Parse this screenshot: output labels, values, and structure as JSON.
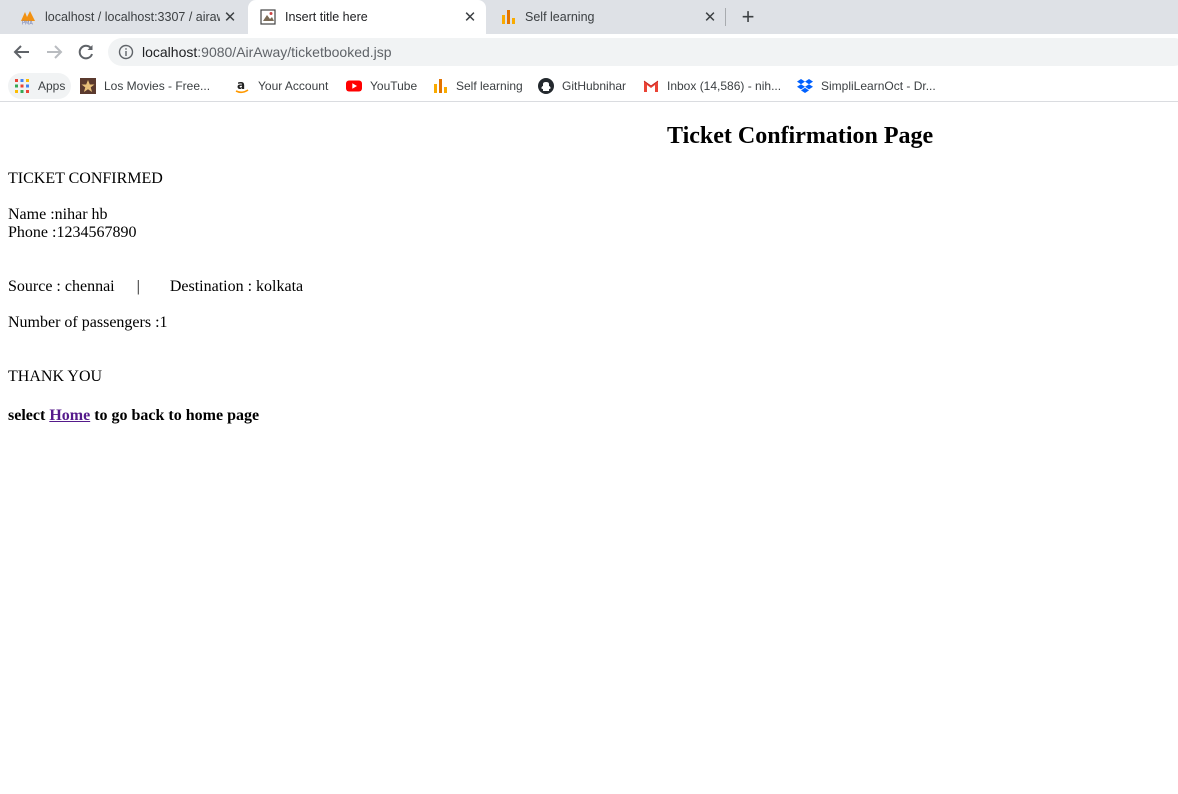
{
  "tabs": [
    {
      "title": "localhost / localhost:3307 / airaw",
      "favicon": "phpmyadmin-icon"
    },
    {
      "title": "Insert title here",
      "favicon": "image-icon"
    },
    {
      "title": "Self learning",
      "favicon": "analytics-icon"
    }
  ],
  "address": {
    "host": "localhost",
    "path": ":9080/AirAway/ticketbooked.jsp"
  },
  "bookmarks": [
    {
      "label": "Apps",
      "icon": "apps-grid-icon"
    },
    {
      "label": "Los Movies - Free...",
      "icon": "movie-icon"
    },
    {
      "label": "Your Account",
      "icon": "amazon-icon"
    },
    {
      "label": "YouTube",
      "icon": "youtube-icon"
    },
    {
      "label": "Self learning",
      "icon": "analytics-icon"
    },
    {
      "label": "GitHubnihar",
      "icon": "github-icon"
    },
    {
      "label": "Inbox (14,586) - nih...",
      "icon": "gmail-icon"
    },
    {
      "label": "SimpliLearnOct - Dr...",
      "icon": "dropbox-icon"
    }
  ],
  "content": {
    "heading": "Ticket Confirmation Page",
    "status": "TICKET CONFIRMED",
    "name_label": "Name :",
    "name_value": "nihar hb",
    "phone_label": "Phone :",
    "phone_value": "1234567890",
    "source_label": "Source : ",
    "source_value": "chennai",
    "separator": "|",
    "destination_label": "Destination : ",
    "destination_value": "kolkata",
    "passengers_label": "Number of passengers :",
    "passengers_value": "1",
    "thanks": "THANK YOU",
    "home_prefix": "select ",
    "home_link": "Home",
    "home_suffix": " to go back to home page"
  },
  "colors": {
    "tabstrip": "#dee1e6",
    "link_visited": "#551a8b",
    "omnibox": "#f1f3f4"
  }
}
